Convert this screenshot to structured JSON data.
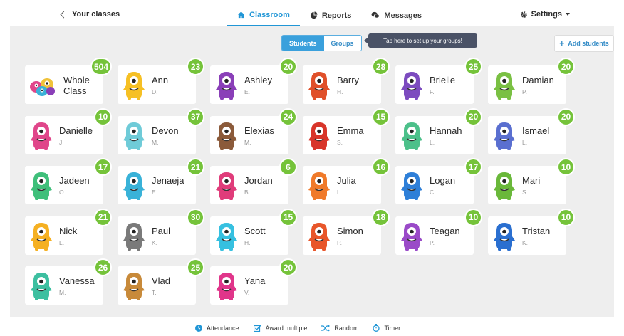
{
  "nav": {
    "back_label": "Your classes",
    "tabs": [
      {
        "label": "Classroom",
        "icon": "home-icon",
        "active": true
      },
      {
        "label": "Reports",
        "icon": "pie-chart-icon",
        "active": false
      },
      {
        "label": "Messages",
        "icon": "chat-icon",
        "active": false
      }
    ],
    "settings_label": "Settings"
  },
  "toolbar": {
    "students_label": "Students",
    "groups_label": "Groups",
    "tooltip": "Tap here to set up your groups!",
    "add_label": "Add students"
  },
  "students": [
    {
      "name": "Whole Class",
      "initial": "",
      "points": "504",
      "color": "#f0c23a",
      "whole": true
    },
    {
      "name": "Ann",
      "initial": "D.",
      "points": "23",
      "color": "#f6c024"
    },
    {
      "name": "Ashley",
      "initial": "E.",
      "points": "20",
      "color": "#8a3fb8"
    },
    {
      "name": "Barry",
      "initial": "H.",
      "points": "28",
      "color": "#e0502a"
    },
    {
      "name": "Brielle",
      "initial": "F.",
      "points": "25",
      "color": "#7c4bbf"
    },
    {
      "name": "Damian",
      "initial": "P.",
      "points": "20",
      "color": "#7ac043"
    },
    {
      "name": "Danielle",
      "initial": "J.",
      "points": "10",
      "color": "#e0468a"
    },
    {
      "name": "Devon",
      "initial": "M.",
      "points": "37",
      "color": "#6fcbd8"
    },
    {
      "name": "Elexias",
      "initial": "M.",
      "points": "24",
      "color": "#8b5a3a"
    },
    {
      "name": "Emma",
      "initial": "S.",
      "points": "15",
      "color": "#d8352a"
    },
    {
      "name": "Hannah",
      "initial": "L.",
      "points": "20",
      "color": "#4cc08a"
    },
    {
      "name": "Ismael",
      "initial": "L.",
      "points": "20",
      "color": "#5a6fd0"
    },
    {
      "name": "Jadeen",
      "initial": "O.",
      "points": "17",
      "color": "#3fbf7a"
    },
    {
      "name": "Jenaeja",
      "initial": "E.",
      "points": "21",
      "color": "#39b2d8"
    },
    {
      "name": "Jordan",
      "initial": "B.",
      "points": "6",
      "color": "#e03c7a"
    },
    {
      "name": "Julia",
      "initial": "L.",
      "points": "16",
      "color": "#f07a2a"
    },
    {
      "name": "Logan",
      "initial": "C.",
      "points": "17",
      "color": "#2e7fd8"
    },
    {
      "name": "Mari",
      "initial": "S.",
      "points": "10",
      "color": "#6ab83a"
    },
    {
      "name": "Nick",
      "initial": "L.",
      "points": "21",
      "color": "#f5b022"
    },
    {
      "name": "Paul",
      "initial": "K.",
      "points": "30",
      "color": "#7a7a7a"
    },
    {
      "name": "Scott",
      "initial": "H.",
      "points": "15",
      "color": "#36c0e0"
    },
    {
      "name": "Simon",
      "initial": "P.",
      "points": "18",
      "color": "#e8562a"
    },
    {
      "name": "Teagan",
      "initial": "P.",
      "points": "10",
      "color": "#9a4ac8"
    },
    {
      "name": "Tristan",
      "initial": "K.",
      "points": "10",
      "color": "#2a6fd0"
    },
    {
      "name": "Vanessa",
      "initial": "M.",
      "points": "26",
      "color": "#3cbfa0"
    },
    {
      "name": "Vlad",
      "initial": "T.",
      "points": "25",
      "color": "#c88a3a"
    },
    {
      "name": "Yana",
      "initial": "V.",
      "points": "20",
      "color": "#e0358a"
    }
  ],
  "footer": {
    "tools": [
      {
        "label": "Attendance",
        "icon": "clock-icon"
      },
      {
        "label": "Award multiple",
        "icon": "checkbox-icon"
      },
      {
        "label": "Random",
        "icon": "shuffle-icon"
      },
      {
        "label": "Timer",
        "icon": "stopwatch-icon"
      }
    ]
  },
  "colors": {
    "accent": "#2196d6",
    "badge": "#75c33a",
    "tooltip": "#4a5266"
  }
}
